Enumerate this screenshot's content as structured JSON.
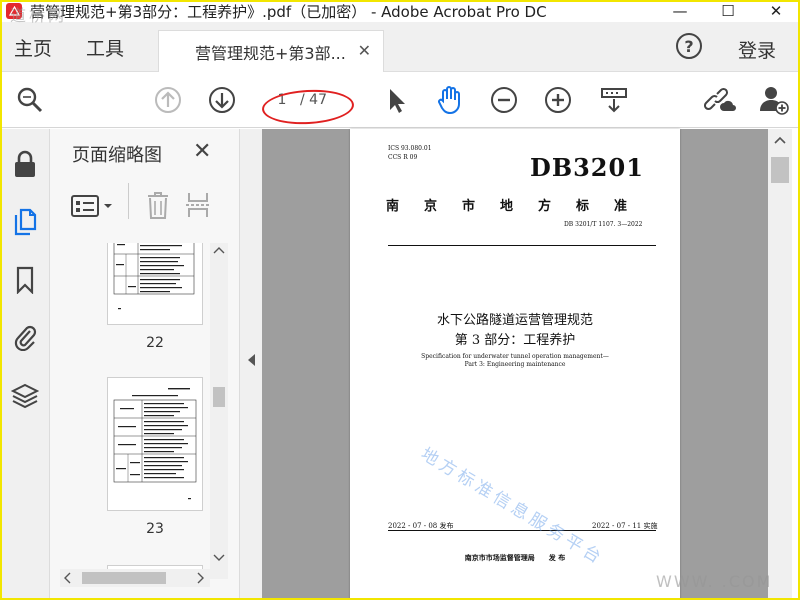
{
  "window": {
    "title": "营管理规范+第3部分：工程养护》.pdf（已加密） - Adobe Acrobat Pro DC",
    "app_icon": "acrobat-icon",
    "minimize": "—",
    "maximize": "☐",
    "close": "✕"
  },
  "watermarks": {
    "top_left": "道桥网",
    "diagonal": "地方标准信息服务平台",
    "bottom_right": "WWW.    .COM"
  },
  "tabs": {
    "home": "主页",
    "tools": "工具",
    "document": "营管理规范+第3部...",
    "document_close": "✕",
    "help": "?",
    "login": "登录"
  },
  "toolbar": {
    "current_page": "1",
    "total_pages": "/ 47",
    "icons": [
      "search-zoom-icon",
      "page-up-icon",
      "page-down-icon",
      "select-cursor-icon",
      "hand-tool-icon",
      "zoom-out-icon",
      "zoom-in-icon",
      "scroll-mode-icon",
      "share-link-icon",
      "add-user-icon"
    ],
    "accent": "#1473e6"
  },
  "sidebar_rail": {
    "icons": [
      "lock-icon",
      "pages-icon",
      "bookmark-icon",
      "attachment-icon",
      "layers-icon"
    ]
  },
  "thumbnails_panel": {
    "title": "页面缩略图",
    "close": "✕",
    "pages": [
      {
        "label": "22"
      },
      {
        "label": "23"
      }
    ]
  },
  "document_page": {
    "ics": "ICS  93.080.01",
    "ccs": "CCS  R 09",
    "db_code": "DB3201",
    "issuer_heading": "南　京　市　地　方　标　准",
    "std_number": "DB 3201/T  1107. 3—2022",
    "title_line1": "水下公路隧道运营管理规范",
    "title_line2": "第 3 部分：工程养护",
    "en_line1": "Specification for underwater tunnel operation management—",
    "en_line2": "Part 3: Engineering maintenance",
    "publish_date": "2022 - 07 - 08 发布",
    "implement_date": "2022 - 07 - 11 实施",
    "publisher": "南京市市场监督管理局　　发 布"
  }
}
